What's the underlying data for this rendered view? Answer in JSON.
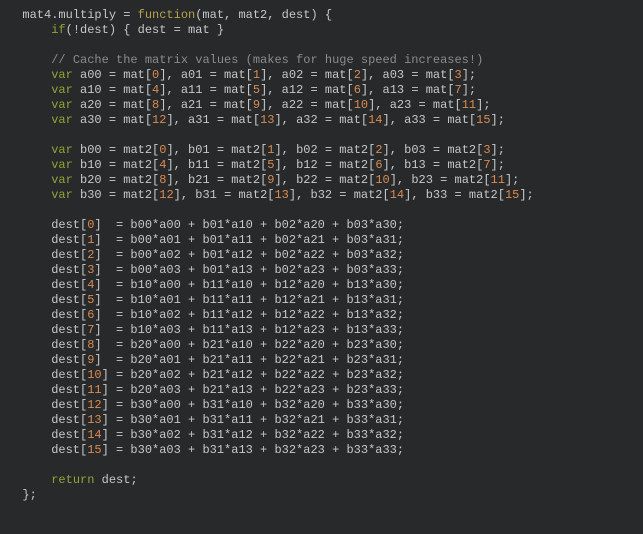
{
  "code": {
    "tokens": [
      [
        [
          "pl",
          "  mat4.multiply = "
        ],
        [
          "fn",
          "function"
        ],
        [
          "pl",
          "(mat, mat2, dest) {"
        ]
      ],
      [
        [
          "pl",
          "      "
        ],
        [
          "kw",
          "if"
        ],
        [
          "pl",
          "(!dest) { dest = mat }"
        ]
      ],
      [
        [
          "pl",
          ""
        ]
      ],
      [
        [
          "pl",
          "      "
        ],
        [
          "cmt",
          "// Cache the matrix values (makes for huge speed increases!)"
        ]
      ],
      [
        [
          "pl",
          "      "
        ],
        [
          "kw",
          "var"
        ],
        [
          "pl",
          " a00 = mat["
        ],
        [
          "num",
          "0"
        ],
        [
          "pl",
          "], a01 = mat["
        ],
        [
          "num",
          "1"
        ],
        [
          "pl",
          "], a02 = mat["
        ],
        [
          "num",
          "2"
        ],
        [
          "pl",
          "], a03 = mat["
        ],
        [
          "num",
          "3"
        ],
        [
          "pl",
          "];"
        ]
      ],
      [
        [
          "pl",
          "      "
        ],
        [
          "kw",
          "var"
        ],
        [
          "pl",
          " a10 = mat["
        ],
        [
          "num",
          "4"
        ],
        [
          "pl",
          "], a11 = mat["
        ],
        [
          "num",
          "5"
        ],
        [
          "pl",
          "], a12 = mat["
        ],
        [
          "num",
          "6"
        ],
        [
          "pl",
          "], a13 = mat["
        ],
        [
          "num",
          "7"
        ],
        [
          "pl",
          "];"
        ]
      ],
      [
        [
          "pl",
          "      "
        ],
        [
          "kw",
          "var"
        ],
        [
          "pl",
          " a20 = mat["
        ],
        [
          "num",
          "8"
        ],
        [
          "pl",
          "], a21 = mat["
        ],
        [
          "num",
          "9"
        ],
        [
          "pl",
          "], a22 = mat["
        ],
        [
          "num",
          "10"
        ],
        [
          "pl",
          "], a23 = mat["
        ],
        [
          "num",
          "11"
        ],
        [
          "pl",
          "];"
        ]
      ],
      [
        [
          "pl",
          "      "
        ],
        [
          "kw",
          "var"
        ],
        [
          "pl",
          " a30 = mat["
        ],
        [
          "num",
          "12"
        ],
        [
          "pl",
          "], a31 = mat["
        ],
        [
          "num",
          "13"
        ],
        [
          "pl",
          "], a32 = mat["
        ],
        [
          "num",
          "14"
        ],
        [
          "pl",
          "], a33 = mat["
        ],
        [
          "num",
          "15"
        ],
        [
          "pl",
          "];"
        ]
      ],
      [
        [
          "pl",
          ""
        ]
      ],
      [
        [
          "pl",
          "      "
        ],
        [
          "kw",
          "var"
        ],
        [
          "pl",
          " b00 = mat2["
        ],
        [
          "num",
          "0"
        ],
        [
          "pl",
          "], b01 = mat2["
        ],
        [
          "num",
          "1"
        ],
        [
          "pl",
          "], b02 = mat2["
        ],
        [
          "num",
          "2"
        ],
        [
          "pl",
          "], b03 = mat2["
        ],
        [
          "num",
          "3"
        ],
        [
          "pl",
          "];"
        ]
      ],
      [
        [
          "pl",
          "      "
        ],
        [
          "kw",
          "var"
        ],
        [
          "pl",
          " b10 = mat2["
        ],
        [
          "num",
          "4"
        ],
        [
          "pl",
          "], b11 = mat2["
        ],
        [
          "num",
          "5"
        ],
        [
          "pl",
          "], b12 = mat2["
        ],
        [
          "num",
          "6"
        ],
        [
          "pl",
          "], b13 = mat2["
        ],
        [
          "num",
          "7"
        ],
        [
          "pl",
          "];"
        ]
      ],
      [
        [
          "pl",
          "      "
        ],
        [
          "kw",
          "var"
        ],
        [
          "pl",
          " b20 = mat2["
        ],
        [
          "num",
          "8"
        ],
        [
          "pl",
          "], b21 = mat2["
        ],
        [
          "num",
          "9"
        ],
        [
          "pl",
          "], b22 = mat2["
        ],
        [
          "num",
          "10"
        ],
        [
          "pl",
          "], b23 = mat2["
        ],
        [
          "num",
          "11"
        ],
        [
          "pl",
          "];"
        ]
      ],
      [
        [
          "pl",
          "      "
        ],
        [
          "kw",
          "var"
        ],
        [
          "pl",
          " b30 = mat2["
        ],
        [
          "num",
          "12"
        ],
        [
          "pl",
          "], b31 = mat2["
        ],
        [
          "num",
          "13"
        ],
        [
          "pl",
          "], b32 = mat2["
        ],
        [
          "num",
          "14"
        ],
        [
          "pl",
          "], b33 = mat2["
        ],
        [
          "num",
          "15"
        ],
        [
          "pl",
          "];"
        ]
      ],
      [
        [
          "pl",
          ""
        ]
      ],
      [
        [
          "pl",
          "      dest["
        ],
        [
          "num",
          "0"
        ],
        [
          "pl",
          "]  = b00*a00 + b01*a10 + b02*a20 + b03*a30;"
        ]
      ],
      [
        [
          "pl",
          "      dest["
        ],
        [
          "num",
          "1"
        ],
        [
          "pl",
          "]  = b00*a01 + b01*a11 + b02*a21 + b03*a31;"
        ]
      ],
      [
        [
          "pl",
          "      dest["
        ],
        [
          "num",
          "2"
        ],
        [
          "pl",
          "]  = b00*a02 + b01*a12 + b02*a22 + b03*a32;"
        ]
      ],
      [
        [
          "pl",
          "      dest["
        ],
        [
          "num",
          "3"
        ],
        [
          "pl",
          "]  = b00*a03 + b01*a13 + b02*a23 + b03*a33;"
        ]
      ],
      [
        [
          "pl",
          "      dest["
        ],
        [
          "num",
          "4"
        ],
        [
          "pl",
          "]  = b10*a00 + b11*a10 + b12*a20 + b13*a30;"
        ]
      ],
      [
        [
          "pl",
          "      dest["
        ],
        [
          "num",
          "5"
        ],
        [
          "pl",
          "]  = b10*a01 + b11*a11 + b12*a21 + b13*a31;"
        ]
      ],
      [
        [
          "pl",
          "      dest["
        ],
        [
          "num",
          "6"
        ],
        [
          "pl",
          "]  = b10*a02 + b11*a12 + b12*a22 + b13*a32;"
        ]
      ],
      [
        [
          "pl",
          "      dest["
        ],
        [
          "num",
          "7"
        ],
        [
          "pl",
          "]  = b10*a03 + b11*a13 + b12*a23 + b13*a33;"
        ]
      ],
      [
        [
          "pl",
          "      dest["
        ],
        [
          "num",
          "8"
        ],
        [
          "pl",
          "]  = b20*a00 + b21*a10 + b22*a20 + b23*a30;"
        ]
      ],
      [
        [
          "pl",
          "      dest["
        ],
        [
          "num",
          "9"
        ],
        [
          "pl",
          "]  = b20*a01 + b21*a11 + b22*a21 + b23*a31;"
        ]
      ],
      [
        [
          "pl",
          "      dest["
        ],
        [
          "num",
          "10"
        ],
        [
          "pl",
          "] = b20*a02 + b21*a12 + b22*a22 + b23*a32;"
        ]
      ],
      [
        [
          "pl",
          "      dest["
        ],
        [
          "num",
          "11"
        ],
        [
          "pl",
          "] = b20*a03 + b21*a13 + b22*a23 + b23*a33;"
        ]
      ],
      [
        [
          "pl",
          "      dest["
        ],
        [
          "num",
          "12"
        ],
        [
          "pl",
          "] = b30*a00 + b31*a10 + b32*a20 + b33*a30;"
        ]
      ],
      [
        [
          "pl",
          "      dest["
        ],
        [
          "num",
          "13"
        ],
        [
          "pl",
          "] = b30*a01 + b31*a11 + b32*a21 + b33*a31;"
        ]
      ],
      [
        [
          "pl",
          "      dest["
        ],
        [
          "num",
          "14"
        ],
        [
          "pl",
          "] = b30*a02 + b31*a12 + b32*a22 + b33*a32;"
        ]
      ],
      [
        [
          "pl",
          "      dest["
        ],
        [
          "num",
          "15"
        ],
        [
          "pl",
          "] = b30*a03 + b31*a13 + b32*a23 + b33*a33;"
        ]
      ],
      [
        [
          "pl",
          ""
        ]
      ],
      [
        [
          "pl",
          "      "
        ],
        [
          "kw",
          "return"
        ],
        [
          "pl",
          " dest;"
        ]
      ],
      [
        [
          "pl",
          "  };"
        ]
      ]
    ]
  }
}
